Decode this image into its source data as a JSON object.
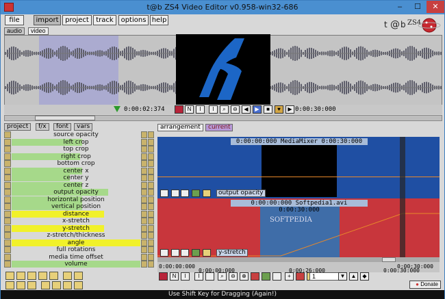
{
  "window": {
    "title": "t@b ZS4 Video Editor v0.958-win32-686",
    "min": "–",
    "max": "☐",
    "close": "✕"
  },
  "menu": [
    "file",
    "import",
    "project",
    "track",
    "options",
    "help"
  ],
  "subtabs": [
    "audio",
    "video"
  ],
  "transport": {
    "current_time": "0:00:02:374",
    "end_time": "0:00:30:000"
  },
  "left_tabs": [
    "project",
    "f/x",
    "font",
    "vars"
  ],
  "params": [
    {
      "label": "source opacity",
      "level": 0.0
    },
    {
      "label": "left crop",
      "level": 0.55
    },
    {
      "label": "top crop",
      "level": 0.0
    },
    {
      "label": "right crop",
      "level": 0.53
    },
    {
      "label": "bottom crop",
      "level": 0.0
    },
    {
      "label": "center x",
      "level": 0.55
    },
    {
      "label": "center y",
      "level": 0.45
    },
    {
      "label": "center z",
      "level": 0.55
    },
    {
      "label": "output opacity",
      "level": 0.75
    },
    {
      "label": "horizontal position",
      "level": 0.55
    },
    {
      "label": "vertical position",
      "level": 0.55
    },
    {
      "label": "distance",
      "level": 0.72,
      "color": "#f1f12a"
    },
    {
      "label": "x-stretch",
      "level": 0.0
    },
    {
      "label": "y-stretch",
      "level": 0.72,
      "color": "#f1f12a"
    },
    {
      "label": "z-stretch/thickness",
      "level": 0.0
    },
    {
      "label": "angle",
      "level": 1.0,
      "color": "#f1f12a"
    },
    {
      "label": "full rotations",
      "level": 0.0
    },
    {
      "label": "media time offset",
      "level": 0.0
    },
    {
      "label": "volume",
      "level": 1.0
    }
  ],
  "right_tabs": [
    "arrangement",
    "current"
  ],
  "tracks": [
    {
      "start": "0:00:00:000",
      "name": "MediaMixer",
      "end": "0:00:30:000",
      "param": "output opacity"
    },
    {
      "start": "0:00:00:000",
      "name": "Softpedia1.avi",
      "end": "0:00:30:000",
      "param": "y-stretch"
    }
  ],
  "ruler": {
    "row1": [
      "0:00:00:000",
      "0:00:30:000"
    ],
    "row2": [
      "0:00:00:000",
      "0:00:26:000",
      "0:00:30:000"
    ]
  },
  "bottom_field": "1",
  "donate": "Donate",
  "status": "Use Shift Key for Dragging (Again!)",
  "watermark": "SOFTPEDIA",
  "colors": {
    "track1": "#1f4fa3",
    "track2": "#c8363c",
    "green": "#a6d98a",
    "yellow": "#f1f12a"
  }
}
